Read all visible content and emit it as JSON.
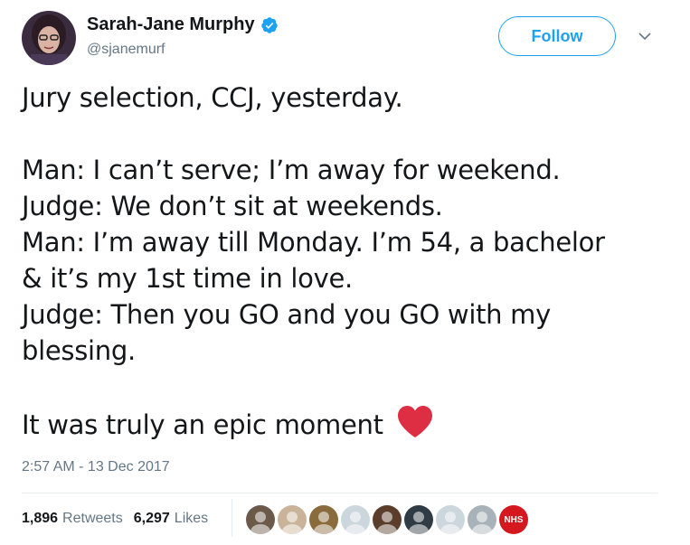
{
  "user": {
    "display_name": "Sarah-Jane Murphy",
    "handle": "@sjanemurf",
    "verified": true,
    "avatar_icon": "profile-photo-icon"
  },
  "follow_label": "Follow",
  "tweet": {
    "lines": [
      "Jury selection, CCJ, yesterday.",
      "",
      "Man: I can’t serve; I’m away for weekend.",
      "Judge: We don’t sit at weekends.",
      "Man: I’m away till Monday. I’m 54, a bachelor",
      "& it’s my 1st time in love.",
      "Judge: Then you GO and you GO with my",
      "blessing.",
      "",
      "It was truly an epic moment"
    ],
    "emoji": "red-heart-icon"
  },
  "timestamp": "2:57 AM - 13 Dec 2017",
  "stats": {
    "retweets_count": "1,896",
    "retweets_label": "Retweets",
    "likes_count": "6,297",
    "likes_label": "Likes"
  },
  "likers": [
    {
      "name": "liker-avatar-1",
      "color": "#6b5a4a"
    },
    {
      "name": "liker-avatar-2",
      "color": "#c9b49a"
    },
    {
      "name": "liker-avatar-3",
      "color": "#8a6b3c"
    },
    {
      "name": "liker-avatar-4",
      "color": "#ccd6dd"
    },
    {
      "name": "liker-avatar-5",
      "color": "#5a3e2b"
    },
    {
      "name": "liker-avatar-6",
      "color": "#2f3b45"
    },
    {
      "name": "liker-avatar-7",
      "color": "#ccd6dd"
    },
    {
      "name": "liker-avatar-8",
      "color": "#a7b2b9"
    },
    {
      "name": "liker-avatar-nhs",
      "color": "#d5171f",
      "text": "NHS"
    }
  ],
  "colors": {
    "accent": "#1da1f2",
    "text": "#14171a",
    "secondary": "#657786",
    "heart": "#dd2e44"
  }
}
